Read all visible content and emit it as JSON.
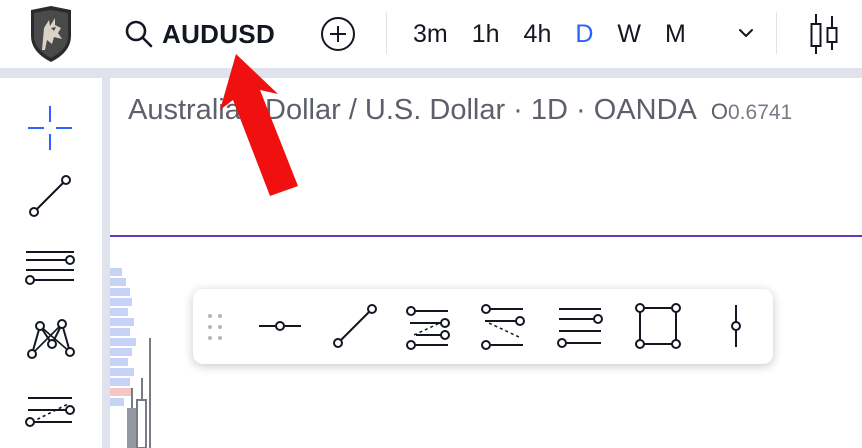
{
  "toolbar": {
    "symbol": "AUDUSD",
    "intervals": [
      "3m",
      "1h",
      "4h",
      "D",
      "W",
      "M"
    ],
    "active_interval": "D"
  },
  "legend": {
    "title": "Australian Dollar / U.S. Dollar · 1D · OANDA",
    "ohlc_open_label": "O",
    "ohlc_open_value": "0.6741"
  },
  "colors": {
    "accent": "#2962ff",
    "price_line": "#673ab7",
    "annotation": "#f01010",
    "text": "#131722"
  },
  "icons": {
    "left_toolbar": [
      "crosshair-icon",
      "trend-line-icon",
      "horizontal-lines-icon",
      "pattern-icon",
      "fib-icon"
    ],
    "floating_panel": [
      "drag-handle-icon",
      "horizontal-ray-icon",
      "trend-line-icon",
      "parallel-channel-icon",
      "disjoint-channel-icon",
      "horizontal-lines-icon",
      "rectangle-icon",
      "vertical-line-icon"
    ]
  }
}
